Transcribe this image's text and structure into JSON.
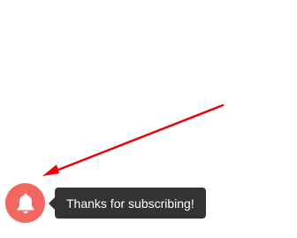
{
  "notification": {
    "bell_icon": "bell-icon",
    "message": "Thanks for subscribing!"
  },
  "colors": {
    "bell_background": "#f16862",
    "bell_icon": "#ffffff",
    "tooltip_background": "#333333",
    "tooltip_text": "#ffffff",
    "annotation_arrow": "#e8000b"
  }
}
